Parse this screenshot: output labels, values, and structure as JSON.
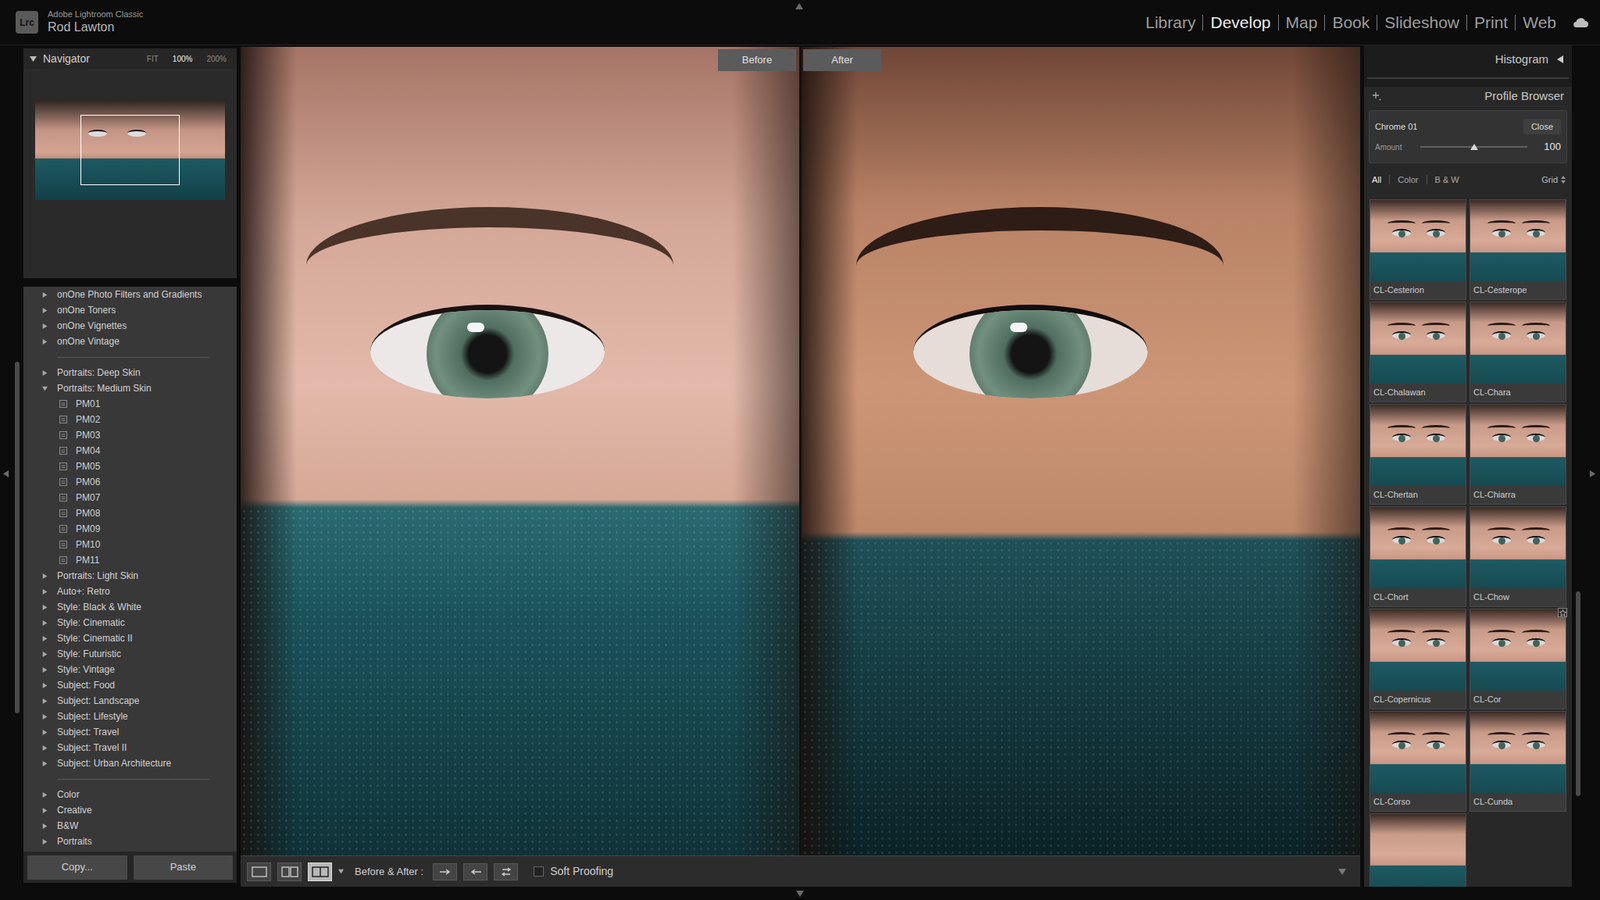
{
  "app": {
    "logo": "Lrc",
    "product": "Adobe Lightroom Classic",
    "user": "Rod Lawton"
  },
  "modules": [
    {
      "label": "Library",
      "selected": false
    },
    {
      "label": "Develop",
      "selected": true
    },
    {
      "label": "Map",
      "selected": false
    },
    {
      "label": "Book",
      "selected": false
    },
    {
      "label": "Slideshow",
      "selected": false
    },
    {
      "label": "Print",
      "selected": false
    },
    {
      "label": "Web",
      "selected": false
    }
  ],
  "navigator": {
    "title": "Navigator",
    "expanded": true,
    "zoom": [
      {
        "label": "FIT",
        "selected": false
      },
      {
        "label": "100%",
        "selected": true
      },
      {
        "label": "200%",
        "selected": false
      }
    ]
  },
  "presets": {
    "sections": [
      [
        {
          "label": "onOne Photo Filters and Gradients",
          "expanded": false,
          "items": []
        },
        {
          "label": "onOne Toners",
          "expanded": false,
          "items": []
        },
        {
          "label": "onOne Vignettes",
          "expanded": false,
          "items": []
        },
        {
          "label": "onOne Vintage",
          "expanded": false,
          "items": []
        }
      ],
      [
        {
          "label": "Portraits: Deep Skin",
          "expanded": false,
          "items": []
        },
        {
          "label": "Portraits: Medium Skin",
          "expanded": true,
          "items": [
            "PM01",
            "PM02",
            "PM03",
            "PM04",
            "PM05",
            "PM06",
            "PM07",
            "PM08",
            "PM09",
            "PM10",
            "PM11"
          ]
        },
        {
          "label": "Portraits: Light Skin",
          "expanded": false,
          "items": []
        },
        {
          "label": "Auto+: Retro",
          "expanded": false,
          "items": []
        },
        {
          "label": "Style: Black & White",
          "expanded": false,
          "items": []
        },
        {
          "label": "Style: Cinematic",
          "expanded": false,
          "items": []
        },
        {
          "label": "Style: Cinematic II",
          "expanded": false,
          "items": []
        },
        {
          "label": "Style: Futuristic",
          "expanded": false,
          "items": []
        },
        {
          "label": "Style: Vintage",
          "expanded": false,
          "items": []
        },
        {
          "label": "Subject: Food",
          "expanded": false,
          "items": []
        },
        {
          "label": "Subject: Landscape",
          "expanded": false,
          "items": []
        },
        {
          "label": "Subject: Lifestyle",
          "expanded": false,
          "items": []
        },
        {
          "label": "Subject: Travel",
          "expanded": false,
          "items": []
        },
        {
          "label": "Subject: Travel II",
          "expanded": false,
          "items": []
        },
        {
          "label": "Subject: Urban Architecture",
          "expanded": false,
          "items": []
        }
      ],
      [
        {
          "label": "Color",
          "expanded": false,
          "items": []
        },
        {
          "label": "Creative",
          "expanded": false,
          "items": []
        },
        {
          "label": "B&W",
          "expanded": false,
          "items": []
        },
        {
          "label": "Portraits",
          "expanded": false,
          "items": []
        }
      ]
    ]
  },
  "left_buttons": [
    "Copy...",
    "Paste"
  ],
  "compare": {
    "before_label": "Before",
    "after_label": "After"
  },
  "toolbar": {
    "view_modes": [
      {
        "kind": "loupe",
        "selected": false
      },
      {
        "kind": "survey",
        "selected": false
      },
      {
        "kind": "before-after",
        "selected": true
      }
    ],
    "label": "Before & After :",
    "actions": [
      {
        "kind": "copy-right"
      },
      {
        "kind": "copy-left"
      },
      {
        "kind": "swap"
      }
    ],
    "soft_proofing": {
      "label": "Soft Proofing",
      "checked": false
    }
  },
  "right_panel": {
    "histogram": {
      "title": "Histogram",
      "expanded": false
    },
    "profile_browser": {
      "title": "Profile Browser",
      "profile": "Chrome 01",
      "close": "Close",
      "amount": {
        "label": "Amount",
        "level": 0.5,
        "reading": "100"
      },
      "filters": [
        {
          "label": "All",
          "selected": true
        },
        {
          "label": "Color",
          "selected": false
        },
        {
          "label": "B & W",
          "selected": false
        }
      ],
      "view": "Grid",
      "thumbnails": [
        {
          "label": "CL-Cesterion",
          "hovered": false
        },
        {
          "label": "CL-Cesterope",
          "hovered": false
        },
        {
          "label": "CL-Chalawan",
          "hovered": false
        },
        {
          "label": "CL-Chara",
          "hovered": false
        },
        {
          "label": "CL-Chertan",
          "hovered": false
        },
        {
          "label": "CL-Chiarra",
          "hovered": false
        },
        {
          "label": "CL-Chort",
          "hovered": false
        },
        {
          "label": "CL-Chow",
          "hovered": false
        },
        {
          "label": "CL-Copernicus",
          "hovered": false
        },
        {
          "label": "CL-Cor",
          "hovered": true
        },
        {
          "label": "CL-Corso",
          "hovered": false
        },
        {
          "label": "CL-Cunda",
          "hovered": false
        }
      ],
      "more_below": true
    }
  }
}
